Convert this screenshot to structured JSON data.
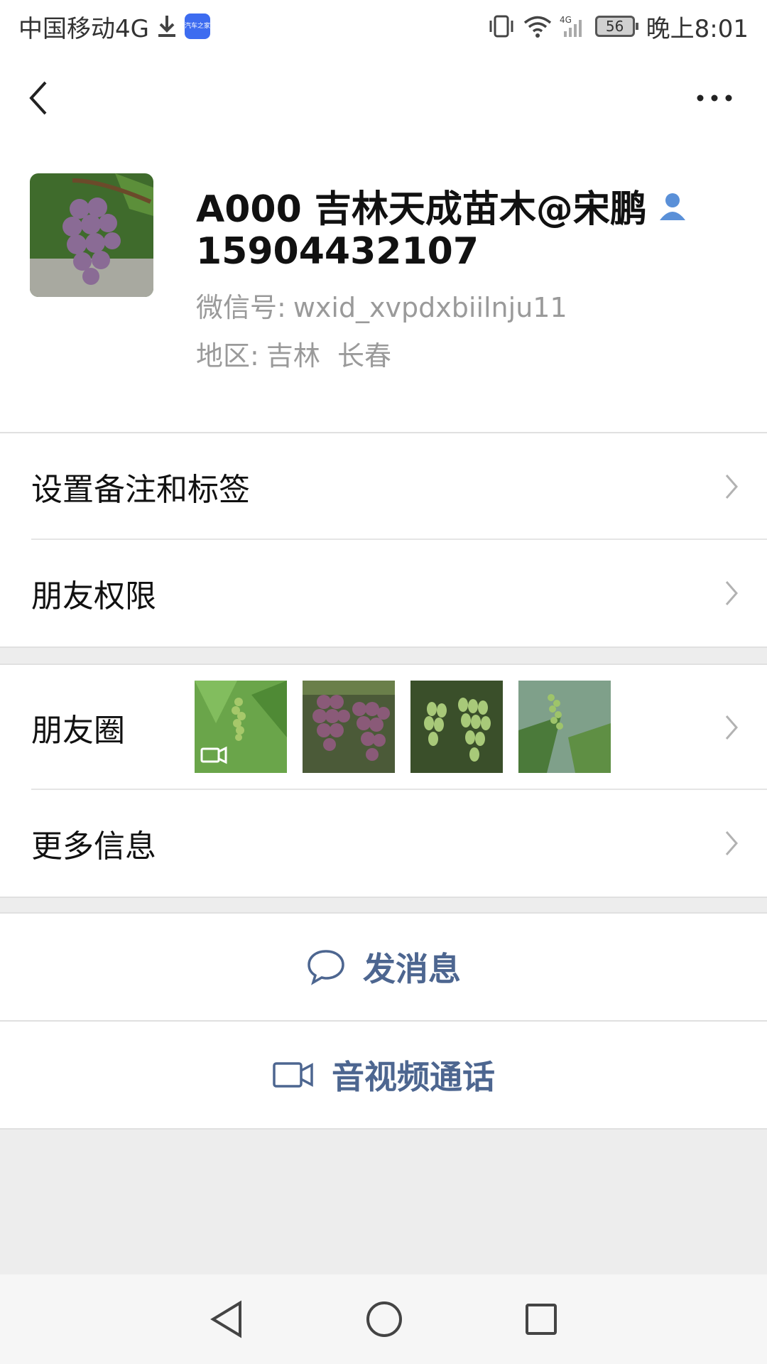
{
  "status_bar": {
    "carrier": "中国移动4G",
    "app_badge": "汽车之家",
    "battery": "56",
    "time": "晚上8:01"
  },
  "profile": {
    "name": "A000 吉林天成苗木@宋鹏",
    "phone": "15904432107",
    "wechat_id_label": "微信号:",
    "wechat_id": "wxid_xvpdxbiilnju11",
    "region_label": "地区:",
    "region": "吉林  长春"
  },
  "menu": {
    "set_remark": "设置备注和标签",
    "friend_permissions": "朋友权限",
    "moments": "朋友圈",
    "more_info": "更多信息"
  },
  "actions": {
    "send_message": "发消息",
    "av_call": "音视频通话"
  },
  "colors": {
    "accent_text": "#4d6690",
    "background": "#ededed",
    "secondary_text": "#9a9a9a"
  }
}
